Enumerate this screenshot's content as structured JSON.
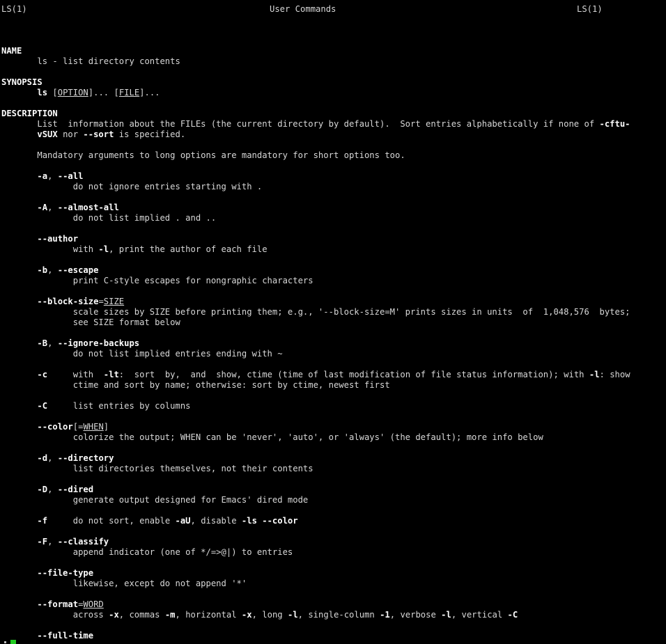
{
  "header": {
    "left": "LS(1)",
    "center": "User Commands",
    "right": "LS(1)"
  },
  "name_section": {
    "heading": "NAME",
    "text": "ls - list directory contents"
  },
  "synopsis": {
    "heading": "SYNOPSIS",
    "cmd": "ls",
    "sp1": " [",
    "option": "OPTION",
    "mid": "]... [",
    "file": "FILE",
    "end": "]..."
  },
  "description": {
    "heading": "DESCRIPTION",
    "p1a": "List  information about the FILEs (the current directory by default).  Sort entries alphabetically if none of ",
    "p1b": "-cftu-",
    "p1c": "vSUX",
    "p1d": " nor ",
    "p1e": "--sort",
    "p1f": " is specified.",
    "p2": "Mandatory arguments to long options are mandatory for short options too."
  },
  "options": {
    "a": {
      "flag1": "-a",
      "sep": ", ",
      "flag2": "--all",
      "desc": "do not ignore entries starting with ."
    },
    "A": {
      "flag1": "-A",
      "sep": ", ",
      "flag2": "--almost-all",
      "desc": "do not list implied . and .."
    },
    "author": {
      "flag": "--author",
      "d1": "with ",
      "d2": "-l",
      "d3": ", print the author of each file"
    },
    "b": {
      "flag1": "-b",
      "sep": ", ",
      "flag2": "--escape",
      "desc": "print C-style escapes for nongraphic characters"
    },
    "block_size": {
      "flag": "--block-size",
      "eq": "=",
      "arg": "SIZE",
      "desc1": "scale sizes by SIZE before printing them; e.g., '--block-size=M' prints sizes in units  of  1,048,576  bytes;",
      "desc2": "see SIZE format below"
    },
    "B": {
      "flag1": "-B",
      "sep": ", ",
      "flag2": "--ignore-backups",
      "desc": "do not list implied entries ending with ~"
    },
    "c": {
      "flag": "-c",
      "d1": "with  ",
      "d2": "-lt",
      "d3": ":  sort  by,  and  show, ctime (time of last modification of file status information); with ",
      "d4": "-l",
      "d5": ": show",
      "desc2": "ctime and sort by name; otherwise: sort by ctime, newest first"
    },
    "C": {
      "flag": "-C",
      "desc": "list entries by columns"
    },
    "color": {
      "flag": "--color",
      "open": "[=",
      "arg": "WHEN",
      "close": "]",
      "desc": "colorize the output; WHEN can be 'never', 'auto', or 'always' (the default); more info below"
    },
    "d": {
      "flag1": "-d",
      "sep": ", ",
      "flag2": "--directory",
      "desc": "list directories themselves, not their contents"
    },
    "D": {
      "flag1": "-D",
      "sep": ", ",
      "flag2": "--dired",
      "desc": "generate output designed for Emacs' dired mode"
    },
    "f": {
      "flag": "-f",
      "d1": "do not sort, enable ",
      "d2": "-aU",
      "d3": ", disable ",
      "d4": "-ls",
      "d5": " ",
      "d6": "--color"
    },
    "F": {
      "flag1": "-F",
      "sep": ", ",
      "flag2": "--classify",
      "desc": "append indicator (one of */=>@|) to entries"
    },
    "file_type": {
      "flag": "--file-type",
      "desc": "likewise, except do not append '*'"
    },
    "format": {
      "flag": "--format",
      "eq": "=",
      "arg": "WORD",
      "t1": "across ",
      "f1": "-x",
      "t2": ", commas ",
      "f2": "-m",
      "t3": ", horizontal ",
      "f3": "-x",
      "t4": ", long ",
      "f4": "-l",
      "t5": ", single-column ",
      "f5": "-1",
      "t6": ", verbose ",
      "f6": "-l",
      "t7": ", vertical ",
      "f7": "-C"
    },
    "full_time": {
      "flag": "--full-time"
    }
  },
  "colors": {
    "background": "#000000",
    "text": "#d8d8d8",
    "bold": "#ffffff",
    "cursor": "#22cc22"
  }
}
